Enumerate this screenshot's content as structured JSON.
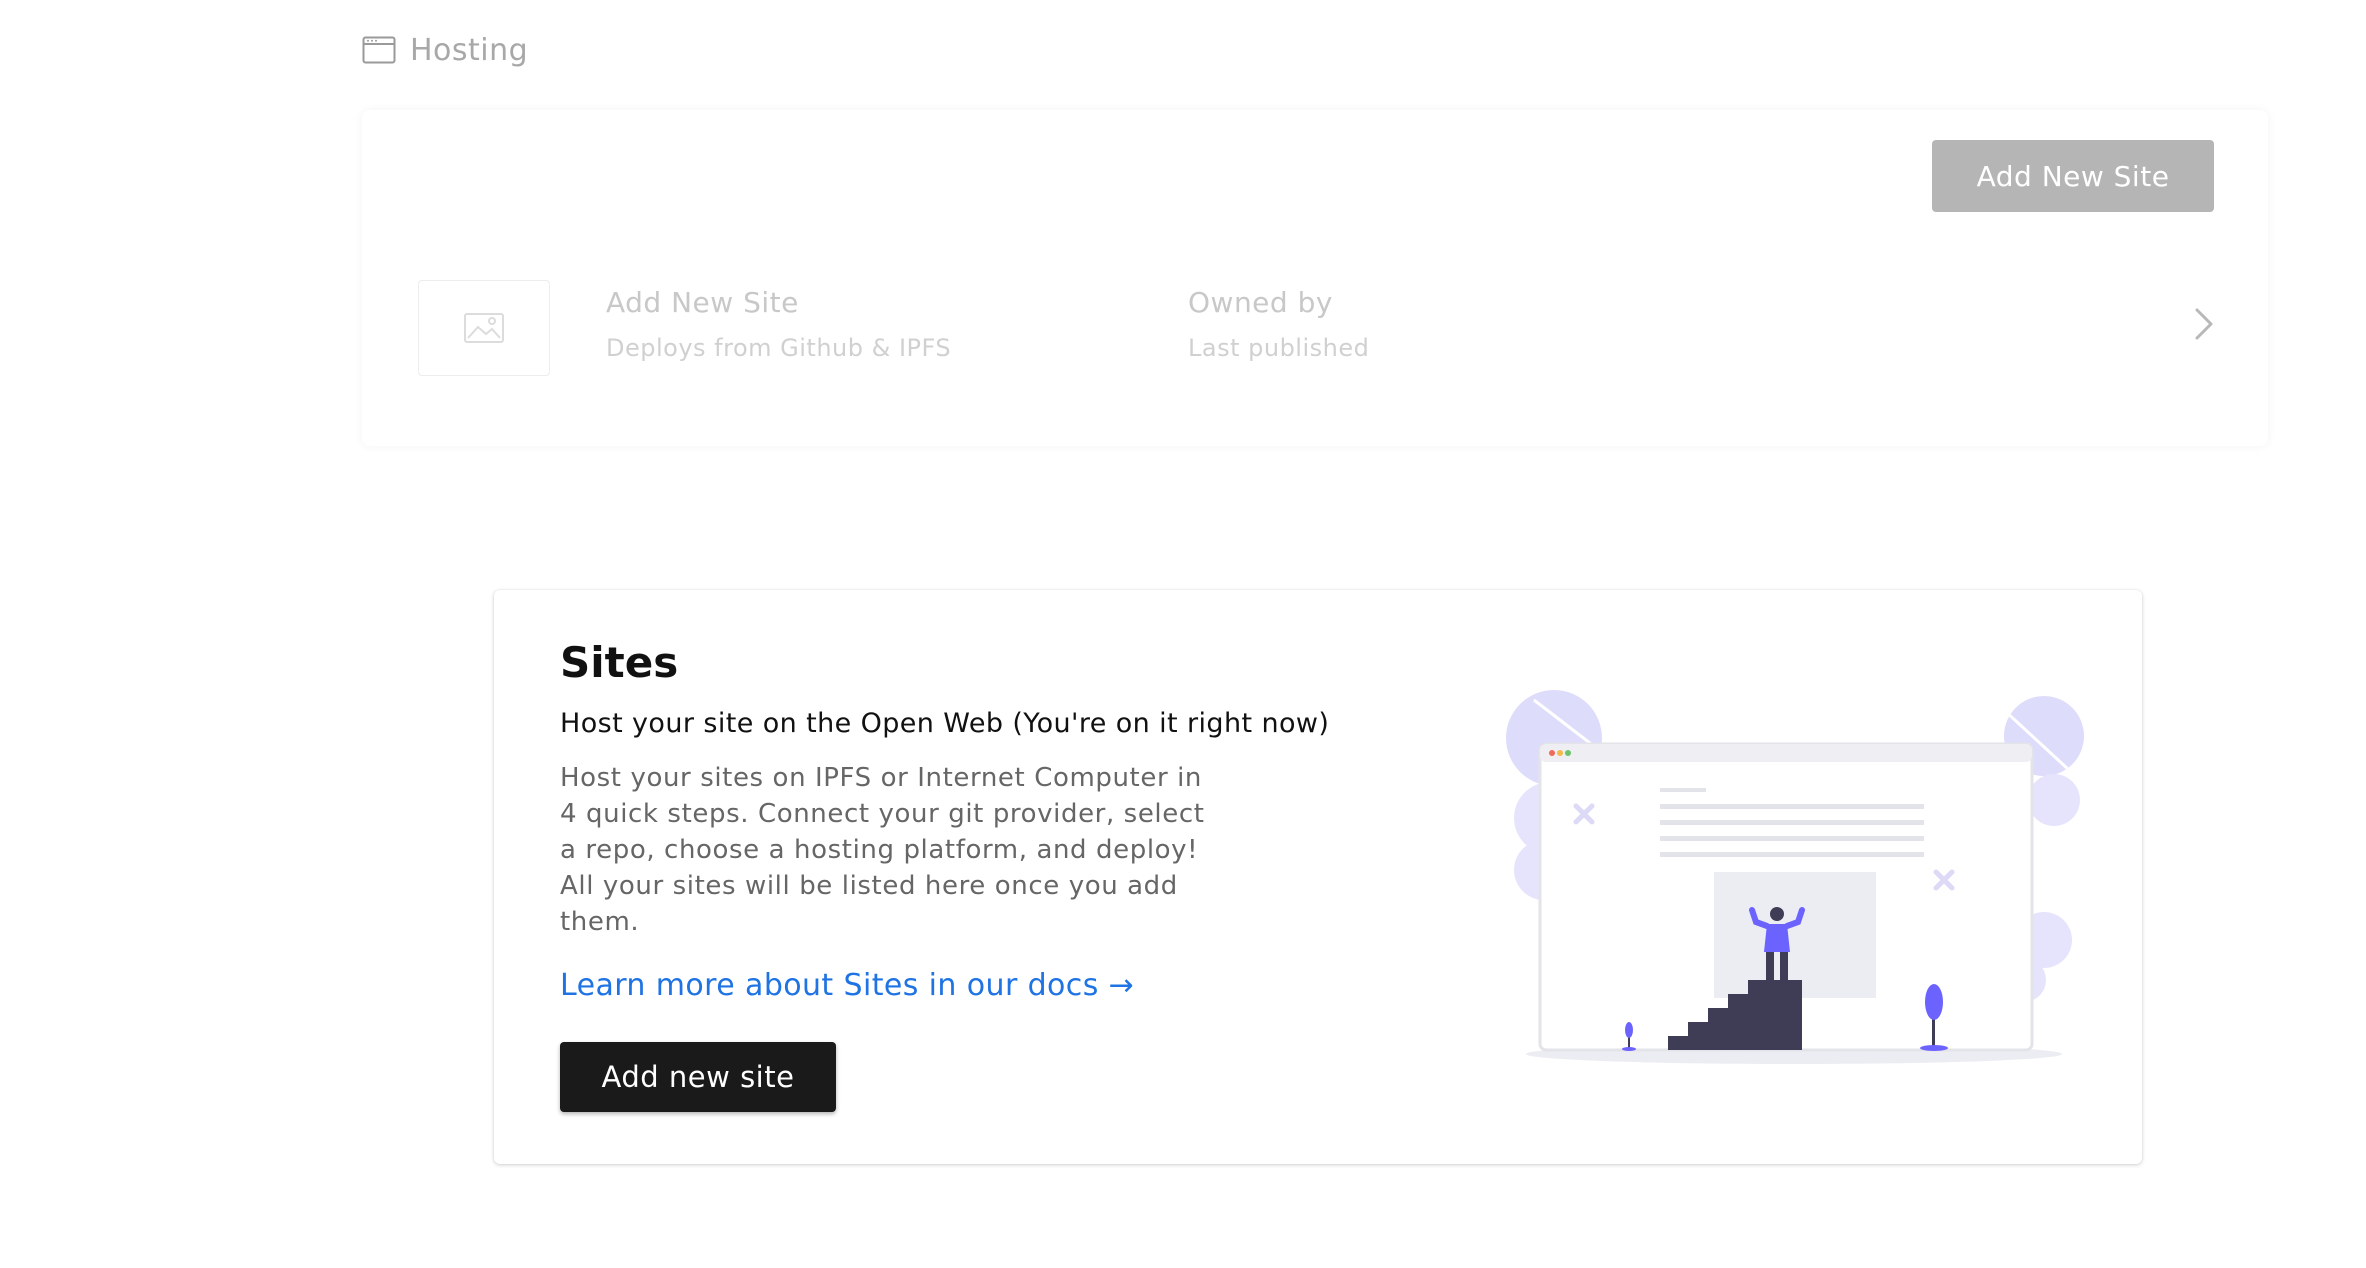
{
  "breadcrumb": {
    "icon": "browser-window-icon",
    "label": "Hosting"
  },
  "sites_list": {
    "add_button_label": "Add New Site",
    "rows": [
      {
        "thumbnail_icon": "image-placeholder-icon",
        "name": "Add New Site",
        "subtitle": "Deploys from Github & IPFS",
        "owner_label": "Owned by",
        "owner_subtitle": "Last published",
        "chevron_icon": "chevron-right-icon"
      }
    ]
  },
  "empty_state": {
    "title": "Sites",
    "subtitle": "Host your site on the Open Web (You're on it right now)",
    "description": "Host your sites on IPFS or Internet Computer in 4 quick steps. Connect your git provider, select a repo, choose a hosting platform, and deploy! All your sites will be listed here once you add them.",
    "docs_link": "Learn more about Sites in our docs →",
    "button_label": "Add new site",
    "illustration": "person-on-stairs-illustration"
  },
  "colors": {
    "accent_link": "#1f73e3",
    "primary_button": "#1a1a1a",
    "disabled_button": "#b5b5b5",
    "illustration_purple": "#6c63ff"
  }
}
